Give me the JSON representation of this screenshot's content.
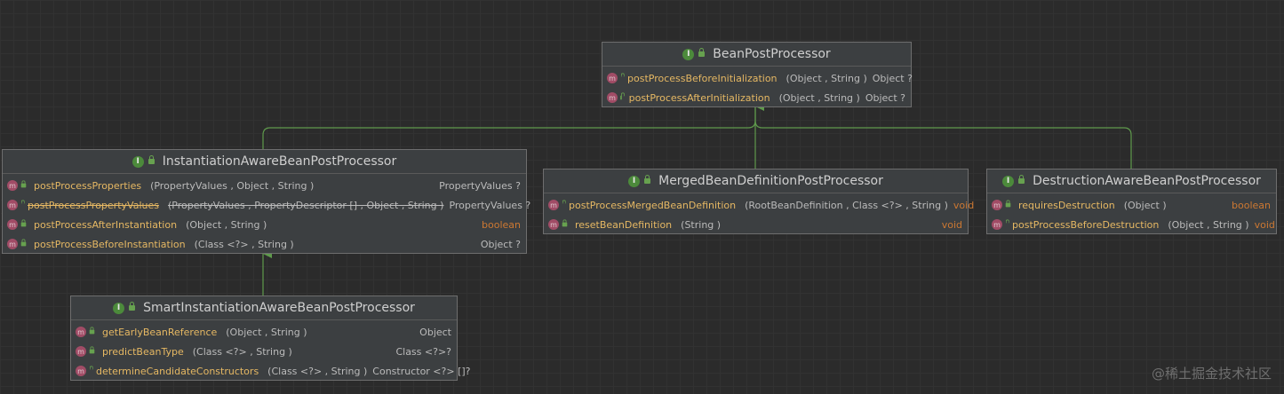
{
  "boxes": {
    "bpp": {
      "name": "BeanPostProcessor",
      "methods": [
        {
          "name": "postProcessBeforeInitialization",
          "params": "(Object , String )",
          "ret": "Object ?"
        },
        {
          "name": "postProcessAfterInitialization",
          "params": "(Object , String )",
          "ret": "Object ?"
        }
      ]
    },
    "iabpp": {
      "name": "InstantiationAwareBeanPostProcessor",
      "methods": [
        {
          "name": "postProcessProperties",
          "params": "(PropertyValues , Object , String )",
          "ret": "PropertyValues ?"
        },
        {
          "name": "postProcessPropertyValues",
          "params": "(PropertyValues , PropertyDescriptor [] , Object , String )",
          "ret": "PropertyValues ?"
        },
        {
          "name": "postProcessAfterInstantiation",
          "params": "(Object , String )",
          "ret": "boolean"
        },
        {
          "name": "postProcessBeforeInstantiation",
          "params": "(Class <?> , String )",
          "ret": "Object ?"
        }
      ]
    },
    "mbdpp": {
      "name": "MergedBeanDefinitionPostProcessor",
      "methods": [
        {
          "name": "postProcessMergedBeanDefinition",
          "params": "(RootBeanDefinition , Class <?> , String )",
          "ret": "void"
        },
        {
          "name": "resetBeanDefinition",
          "params": "(String )",
          "ret": "void"
        }
      ]
    },
    "dabpp": {
      "name": "DestructionAwareBeanPostProcessor",
      "methods": [
        {
          "name": "requiresDestruction",
          "params": "(Object )",
          "ret": "boolean"
        },
        {
          "name": "postProcessBeforeDestruction",
          "params": "(Object , String )",
          "ret": "void"
        }
      ]
    },
    "siabpp": {
      "name": "SmartInstantiationAwareBeanPostProcessor",
      "methods": [
        {
          "name": "getEarlyBeanReference",
          "params": "(Object , String )",
          "ret": "Object"
        },
        {
          "name": "predictBeanType",
          "params": "(Class <?> , String )",
          "ret": "Class <?>?"
        },
        {
          "name": "determineCandidateConstructors",
          "params": "(Class <?> , String )",
          "ret": "Constructor <?> []?"
        }
      ]
    }
  },
  "badges": {
    "interface": "I",
    "method": "m"
  },
  "watermark": "@稀土掘金技术社区",
  "colors": {
    "background": "#2b2b2b",
    "box": "#3c3f41",
    "method_name": "#e6b863",
    "keyword_return": "#cc7832",
    "edge": "#5f9a4c",
    "interface_badge": "#4c8a3b",
    "method_badge": "#a14c66"
  },
  "icons": [
    "interface-icon",
    "method-icon",
    "public-lock-icon",
    "inheritance-arrow-icon"
  ]
}
